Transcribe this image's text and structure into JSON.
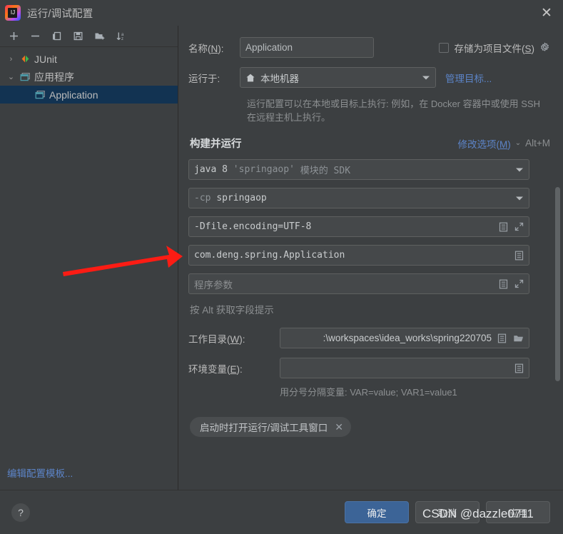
{
  "window": {
    "title": "运行/调试配置",
    "close_label": "✕",
    "logo_icon": "intellij-idea-logo"
  },
  "toolbar": {
    "items": [
      {
        "name": "add-configuration-button",
        "icon": "plus-icon",
        "label": "+"
      },
      {
        "name": "remove-configuration-button",
        "icon": "minus-icon",
        "label": "−"
      },
      {
        "name": "copy-configuration-button",
        "icon": "copy-icon",
        "label": "Copy"
      },
      {
        "name": "save-configuration-button",
        "icon": "save-icon",
        "label": "Save"
      },
      {
        "name": "new-folder-button",
        "icon": "folder-add-icon",
        "label": "New Folder"
      },
      {
        "name": "sort-button",
        "icon": "sort-az-icon",
        "label": "Sort"
      }
    ]
  },
  "tree": {
    "nodes": [
      {
        "label": "JUnit",
        "icon": "junit-icon",
        "twisty": "›",
        "expanded": false,
        "selected": false,
        "child": false
      },
      {
        "label": "应用程序",
        "icon": "application-folder-icon",
        "twisty": "⌄",
        "expanded": true,
        "selected": false,
        "child": false
      },
      {
        "label": "Application",
        "icon": "application-icon",
        "twisty": "",
        "expanded": false,
        "selected": true,
        "child": true
      }
    ],
    "edit_templates_link": "编辑配置模板..."
  },
  "form": {
    "name_label": "名称(N):",
    "name_mnemonic": "N",
    "name_value": "Application",
    "store_as_project_file_label": "存储为项目文件(S)",
    "store_as_project_file_mnemonic": "S",
    "store_as_project_file_checked": false,
    "gear_icon": "gear-icon",
    "run_on_label": "运行于:",
    "run_on_value": "本地机器",
    "run_on_icon": "home-icon",
    "manage_targets_link": "管理目标...",
    "target_hint": "运行配置可以在本地或目标上执行: 例如，在 Docker 容器中或使用 SSH 在远程主机上执行。"
  },
  "build_and_run": {
    "section_title": "构建并运行",
    "modify_options_link": "修改选项(M)",
    "modify_options_mnemonic": "M",
    "modify_options_caret": "⌄",
    "shortcut": "Alt+M",
    "jdk_value": "java 8",
    "jdk_suffix_quoted": "'springaop'",
    "jdk_suffix_rest": "模块的 SDK",
    "classpath_flag": "-cp",
    "classpath_value": "springaop",
    "vm_options_value": "-Dfile.encoding=UTF-8",
    "main_class_value": "com.deng.spring.Application",
    "program_args_placeholder": "程序参数",
    "alt_hint": "按 Alt 获取字段提示",
    "expand_icon": "expand-icon",
    "list_icon": "list-icon"
  },
  "paths": {
    "working_dir_label": "工作目录(W):",
    "working_dir_mnemonic": "W",
    "working_dir_value": ":\\workspaces\\idea_works\\spring220705",
    "browse_icon": "folder-open-icon",
    "env_vars_label": "环境变量(E):",
    "env_vars_mnemonic": "E",
    "env_vars_value": "",
    "env_vars_hint": "用分号分隔变量: VAR=value; VAR1=value1"
  },
  "chips": [
    {
      "label": "启动时打开运行/调试工具窗口",
      "close": "✕"
    }
  ],
  "footer": {
    "help_label": "?",
    "ok_label": "确定",
    "cancel_label": "取消",
    "apply_label": "应用"
  },
  "annotation": {
    "arrow_color": "#fc1c14",
    "watermark_text": "CSDN @dazzle0711"
  },
  "colors": {
    "background": "#3c3f41",
    "selection": "#123352",
    "link": "#5c84c8",
    "primary_button": "#3c6497",
    "field_background": "#45484a"
  }
}
